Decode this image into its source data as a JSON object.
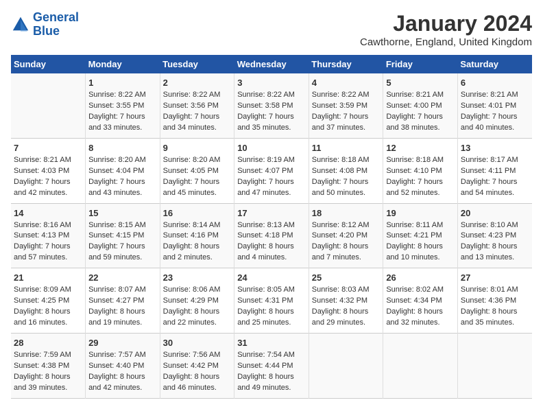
{
  "header": {
    "logo_line1": "General",
    "logo_line2": "Blue",
    "month": "January 2024",
    "location": "Cawthorne, England, United Kingdom"
  },
  "days_of_week": [
    "Sunday",
    "Monday",
    "Tuesday",
    "Wednesday",
    "Thursday",
    "Friday",
    "Saturday"
  ],
  "weeks": [
    [
      {
        "num": "",
        "lines": []
      },
      {
        "num": "1",
        "lines": [
          "Sunrise: 8:22 AM",
          "Sunset: 3:55 PM",
          "Daylight: 7 hours",
          "and 33 minutes."
        ]
      },
      {
        "num": "2",
        "lines": [
          "Sunrise: 8:22 AM",
          "Sunset: 3:56 PM",
          "Daylight: 7 hours",
          "and 34 minutes."
        ]
      },
      {
        "num": "3",
        "lines": [
          "Sunrise: 8:22 AM",
          "Sunset: 3:58 PM",
          "Daylight: 7 hours",
          "and 35 minutes."
        ]
      },
      {
        "num": "4",
        "lines": [
          "Sunrise: 8:22 AM",
          "Sunset: 3:59 PM",
          "Daylight: 7 hours",
          "and 37 minutes."
        ]
      },
      {
        "num": "5",
        "lines": [
          "Sunrise: 8:21 AM",
          "Sunset: 4:00 PM",
          "Daylight: 7 hours",
          "and 38 minutes."
        ]
      },
      {
        "num": "6",
        "lines": [
          "Sunrise: 8:21 AM",
          "Sunset: 4:01 PM",
          "Daylight: 7 hours",
          "and 40 minutes."
        ]
      }
    ],
    [
      {
        "num": "7",
        "lines": [
          "Sunrise: 8:21 AM",
          "Sunset: 4:03 PM",
          "Daylight: 7 hours",
          "and 42 minutes."
        ]
      },
      {
        "num": "8",
        "lines": [
          "Sunrise: 8:20 AM",
          "Sunset: 4:04 PM",
          "Daylight: 7 hours",
          "and 43 minutes."
        ]
      },
      {
        "num": "9",
        "lines": [
          "Sunrise: 8:20 AM",
          "Sunset: 4:05 PM",
          "Daylight: 7 hours",
          "and 45 minutes."
        ]
      },
      {
        "num": "10",
        "lines": [
          "Sunrise: 8:19 AM",
          "Sunset: 4:07 PM",
          "Daylight: 7 hours",
          "and 47 minutes."
        ]
      },
      {
        "num": "11",
        "lines": [
          "Sunrise: 8:18 AM",
          "Sunset: 4:08 PM",
          "Daylight: 7 hours",
          "and 50 minutes."
        ]
      },
      {
        "num": "12",
        "lines": [
          "Sunrise: 8:18 AM",
          "Sunset: 4:10 PM",
          "Daylight: 7 hours",
          "and 52 minutes."
        ]
      },
      {
        "num": "13",
        "lines": [
          "Sunrise: 8:17 AM",
          "Sunset: 4:11 PM",
          "Daylight: 7 hours",
          "and 54 minutes."
        ]
      }
    ],
    [
      {
        "num": "14",
        "lines": [
          "Sunrise: 8:16 AM",
          "Sunset: 4:13 PM",
          "Daylight: 7 hours",
          "and 57 minutes."
        ]
      },
      {
        "num": "15",
        "lines": [
          "Sunrise: 8:15 AM",
          "Sunset: 4:15 PM",
          "Daylight: 7 hours",
          "and 59 minutes."
        ]
      },
      {
        "num": "16",
        "lines": [
          "Sunrise: 8:14 AM",
          "Sunset: 4:16 PM",
          "Daylight: 8 hours",
          "and 2 minutes."
        ]
      },
      {
        "num": "17",
        "lines": [
          "Sunrise: 8:13 AM",
          "Sunset: 4:18 PM",
          "Daylight: 8 hours",
          "and 4 minutes."
        ]
      },
      {
        "num": "18",
        "lines": [
          "Sunrise: 8:12 AM",
          "Sunset: 4:20 PM",
          "Daylight: 8 hours",
          "and 7 minutes."
        ]
      },
      {
        "num": "19",
        "lines": [
          "Sunrise: 8:11 AM",
          "Sunset: 4:21 PM",
          "Daylight: 8 hours",
          "and 10 minutes."
        ]
      },
      {
        "num": "20",
        "lines": [
          "Sunrise: 8:10 AM",
          "Sunset: 4:23 PM",
          "Daylight: 8 hours",
          "and 13 minutes."
        ]
      }
    ],
    [
      {
        "num": "21",
        "lines": [
          "Sunrise: 8:09 AM",
          "Sunset: 4:25 PM",
          "Daylight: 8 hours",
          "and 16 minutes."
        ]
      },
      {
        "num": "22",
        "lines": [
          "Sunrise: 8:07 AM",
          "Sunset: 4:27 PM",
          "Daylight: 8 hours",
          "and 19 minutes."
        ]
      },
      {
        "num": "23",
        "lines": [
          "Sunrise: 8:06 AM",
          "Sunset: 4:29 PM",
          "Daylight: 8 hours",
          "and 22 minutes."
        ]
      },
      {
        "num": "24",
        "lines": [
          "Sunrise: 8:05 AM",
          "Sunset: 4:31 PM",
          "Daylight: 8 hours",
          "and 25 minutes."
        ]
      },
      {
        "num": "25",
        "lines": [
          "Sunrise: 8:03 AM",
          "Sunset: 4:32 PM",
          "Daylight: 8 hours",
          "and 29 minutes."
        ]
      },
      {
        "num": "26",
        "lines": [
          "Sunrise: 8:02 AM",
          "Sunset: 4:34 PM",
          "Daylight: 8 hours",
          "and 32 minutes."
        ]
      },
      {
        "num": "27",
        "lines": [
          "Sunrise: 8:01 AM",
          "Sunset: 4:36 PM",
          "Daylight: 8 hours",
          "and 35 minutes."
        ]
      }
    ],
    [
      {
        "num": "28",
        "lines": [
          "Sunrise: 7:59 AM",
          "Sunset: 4:38 PM",
          "Daylight: 8 hours",
          "and 39 minutes."
        ]
      },
      {
        "num": "29",
        "lines": [
          "Sunrise: 7:57 AM",
          "Sunset: 4:40 PM",
          "Daylight: 8 hours",
          "and 42 minutes."
        ]
      },
      {
        "num": "30",
        "lines": [
          "Sunrise: 7:56 AM",
          "Sunset: 4:42 PM",
          "Daylight: 8 hours",
          "and 46 minutes."
        ]
      },
      {
        "num": "31",
        "lines": [
          "Sunrise: 7:54 AM",
          "Sunset: 4:44 PM",
          "Daylight: 8 hours",
          "and 49 minutes."
        ]
      },
      {
        "num": "",
        "lines": []
      },
      {
        "num": "",
        "lines": []
      },
      {
        "num": "",
        "lines": []
      }
    ]
  ]
}
